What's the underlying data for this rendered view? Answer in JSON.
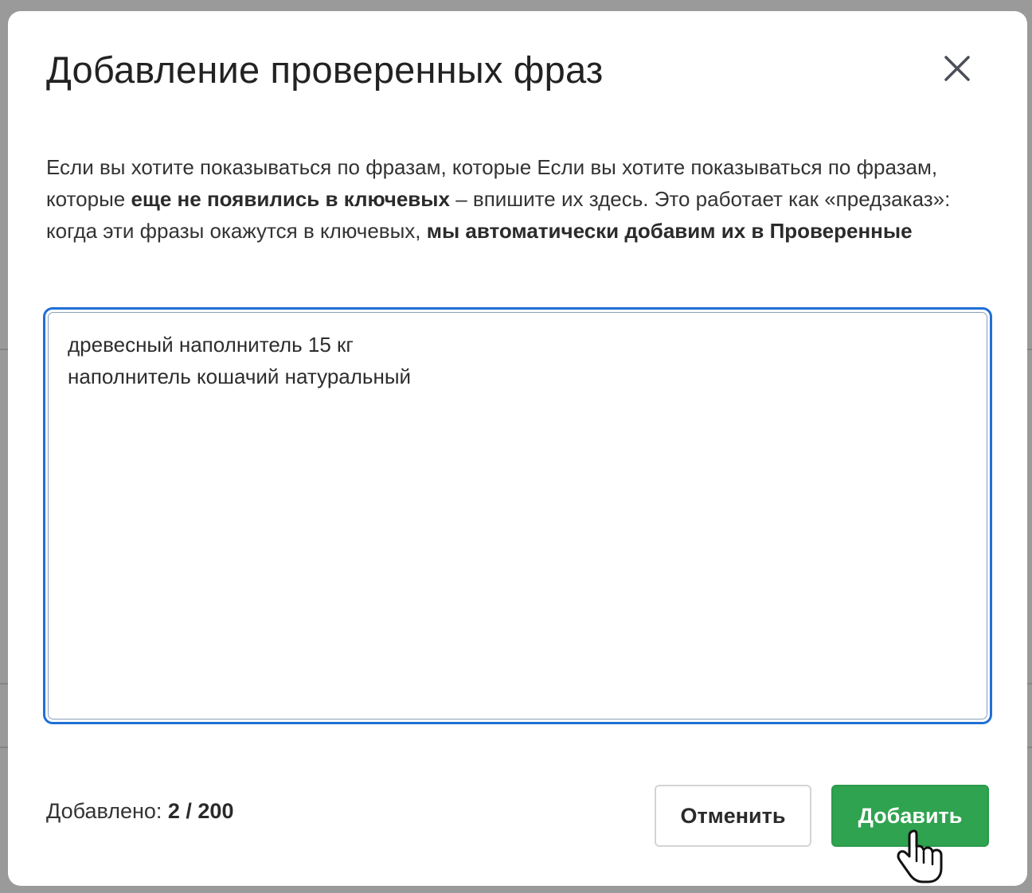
{
  "dialog": {
    "title": "Добавление проверенных фраз",
    "description": {
      "part1": "Если вы хотите показываться по фразам, которые Если вы хотите показываться по фразам, которые ",
      "bold1": "еще не появились в ключевых",
      "part2": " – впишите их здесь. Это работает как «предзаказ»: когда эти фразы окажутся в ключевых, ",
      "bold2": "мы автоматически добавим их в Проверенные"
    },
    "phrases": [
      "древесный наполнитель 15 кг",
      "наполнитель кошачий натуральный"
    ],
    "counter": {
      "label": "Добавлено: ",
      "value": "2 / 200"
    },
    "buttons": {
      "cancel": "Отменить",
      "add": "Добавить"
    }
  },
  "colors": {
    "accent_green": "#2fa34f",
    "focus_blue": "#1f6fd6"
  },
  "icons": {
    "close": "close-icon",
    "cursor": "hand-pointer-icon"
  }
}
